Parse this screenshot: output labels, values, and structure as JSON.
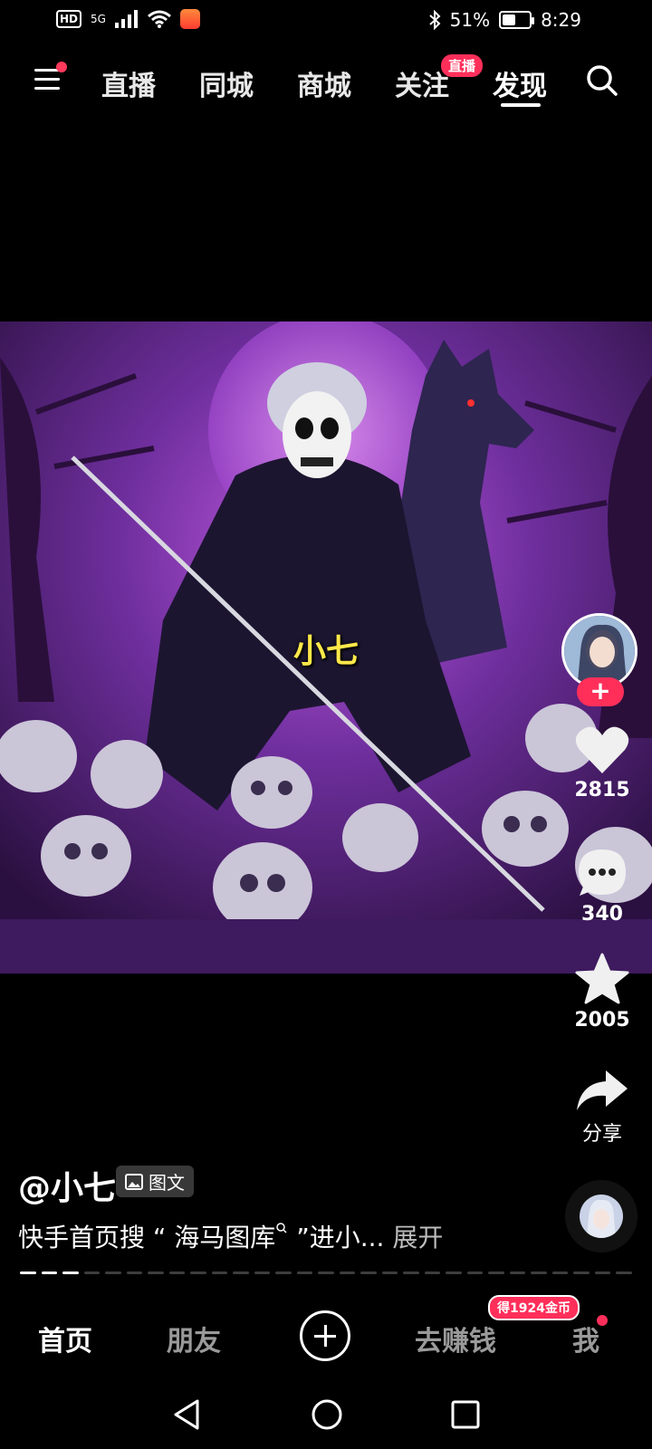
{
  "status_bar": {
    "hd": "HD",
    "network": "5G",
    "battery_pct_text": "51%",
    "battery_level": 0.51,
    "time": "8:29"
  },
  "top_nav": {
    "tabs": [
      {
        "label": "直播"
      },
      {
        "label": "同城"
      },
      {
        "label": "商城"
      },
      {
        "label": "关注"
      },
      {
        "label": "发现"
      }
    ],
    "live_badge": "直播",
    "active_tab": "发现"
  },
  "post": {
    "image_caption": "小七",
    "author": "@小七",
    "type_badge": "图文",
    "description": "快手首页搜 “ 海马图库",
    "description_tail": " ”进小...",
    "expand_label": "展开"
  },
  "actions": {
    "likes": "2815",
    "comments": "340",
    "favorites": "2005",
    "share_label": "分享",
    "follow_label": "+"
  },
  "bottom_nav": {
    "home": "首页",
    "friends": "朋友",
    "earn": "去赚钱",
    "earn_badge": "得1924金币",
    "me": "我"
  },
  "colors": {
    "accent": "#ff2f5a",
    "caption": "#ffe84a",
    "image_bg": "#6a2e9a"
  }
}
